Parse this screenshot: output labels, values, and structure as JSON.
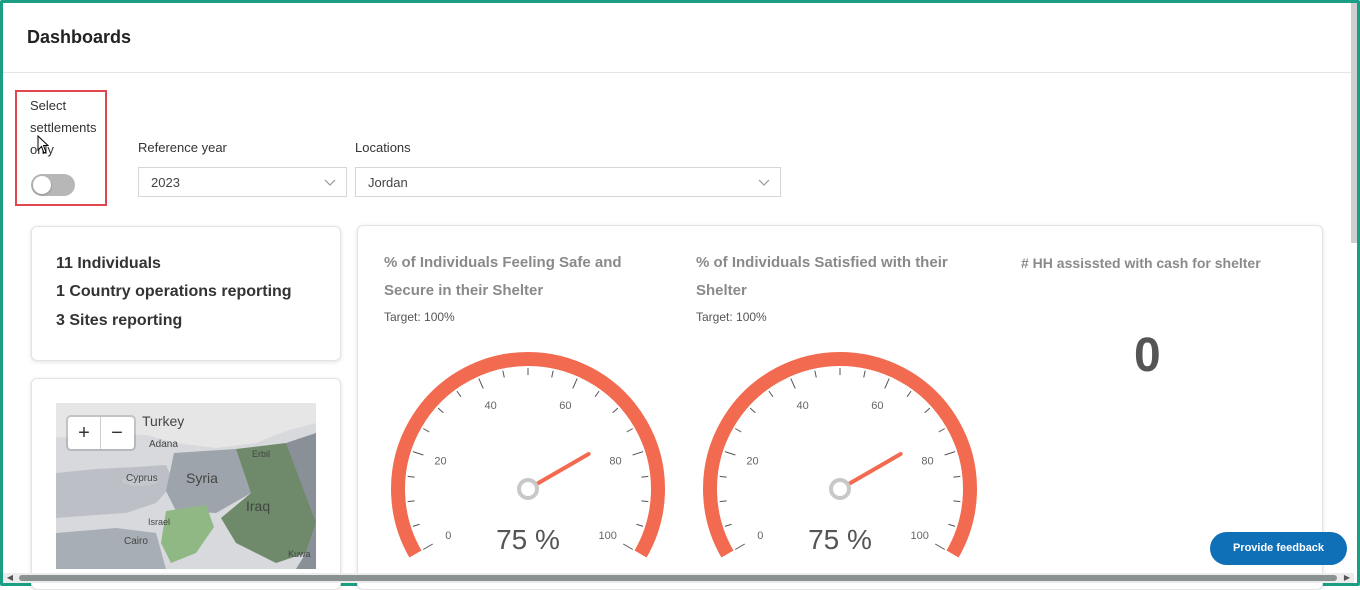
{
  "header": {
    "title": "Dashboards"
  },
  "filters": {
    "settlements_toggle": {
      "label": "Select settlements only",
      "checked": false
    },
    "reference_year": {
      "label": "Reference year",
      "value": "2023"
    },
    "locations": {
      "label": "Locations",
      "value": "Jordan"
    }
  },
  "stats": {
    "individuals": "11 Individuals",
    "countries": "1 Country operations reporting",
    "sites": "3 Sites reporting"
  },
  "map": {
    "labels": [
      "Turkey",
      "Adana",
      "Syria",
      "Cyprus",
      "Iraq",
      "Israel",
      "Cairo",
      "Erbil",
      "Kuwa"
    ],
    "zoom_in": "+",
    "zoom_out": "−"
  },
  "gauges": [
    {
      "title_line1": "% of Individuals Feeling Safe and",
      "title_line2": "Secure in their Shelter",
      "target": "Target: 100%",
      "value": 75,
      "value_text": "75 %",
      "ticks": [
        "0",
        "20",
        "40",
        "60",
        "80",
        "100"
      ]
    },
    {
      "title_line1": "% of Individuals Satisfied with their",
      "title_line2": "Shelter",
      "target": "Target: 100%",
      "value": 75,
      "value_text": "75 %",
      "ticks": [
        "0",
        "20",
        "40",
        "60",
        "80",
        "100"
      ]
    }
  ],
  "cash": {
    "title": "# HH assissted with cash for shelter",
    "value": "0"
  },
  "feedback": {
    "label": "Provide feedback"
  },
  "colors": {
    "accent": "#1a9e84",
    "gauge": "#f26b50",
    "feedback": "#0f70b7",
    "highlight": "#e0474c"
  }
}
